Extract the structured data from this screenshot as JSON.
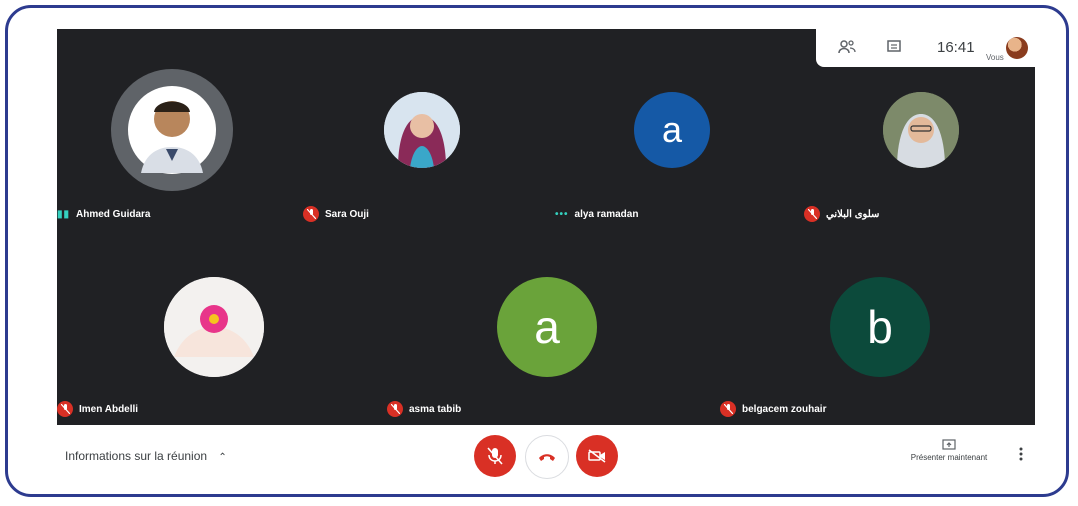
{
  "topbar": {
    "time": "16:41",
    "you_label": "Vous"
  },
  "participants": [
    {
      "name": "Ahmed Guidara",
      "status": "speaking"
    },
    {
      "name": "Sara Ouji",
      "status": "muted"
    },
    {
      "name": "alya ramadan",
      "status": "active",
      "initial": "a",
      "color": "#1559a6"
    },
    {
      "name": "سلوى البلاني",
      "status": "muted"
    },
    {
      "name": "Imen Abdelli",
      "status": "muted"
    },
    {
      "name": "asma tabib",
      "status": "muted",
      "initial": "a",
      "color": "#6aa33a"
    },
    {
      "name": "belgacem zouhair",
      "status": "muted",
      "initial": "b",
      "color": "#0c4a3b"
    }
  ],
  "bottombar": {
    "meeting_info": "Informations sur la réunion",
    "present_label": "Présenter maintenant"
  },
  "colors": {
    "end_call": "#ffffff",
    "control_red": "#d93025",
    "stage_bg": "#202124"
  }
}
